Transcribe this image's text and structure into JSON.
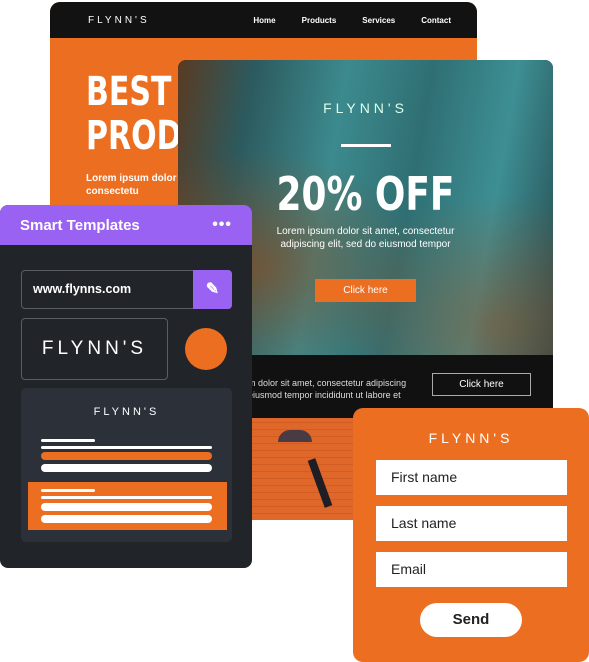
{
  "back_card": {
    "logo": "FLYNN'S",
    "nav": [
      "Home",
      "Products",
      "Services",
      "Contact"
    ],
    "headline_1": "BEST W",
    "headline_2": "PRODU",
    "body": "Lorem ipsum dolor sit amet consectetu"
  },
  "promo_card": {
    "logo": "FLYNN'S",
    "headline": "20% OFF",
    "body": "Lorem ipsum dolor sit amet, consectetur adipiscing elit, sed do eiusmod tempor",
    "cta": "Click here",
    "strip_text_1": "m dolor sit amet, consectetur adipiscing",
    "strip_text_2": "eiusmod tempor incididunt ut labore et",
    "strip_cta": "Click here"
  },
  "smart_templates": {
    "title": "Smart Templates",
    "menu_icon": "more-horizontal-icon",
    "url_value": "www.flynns.com",
    "wand_icon": "magic-wand-icon",
    "logo": "FLYNN'S",
    "brand_color": "#ec6e21",
    "preview_logo": "FLYNN'S",
    "accent": "#9a62f2"
  },
  "form_card": {
    "logo": "FLYNN'S",
    "fields": [
      "First name",
      "Last name",
      "Email"
    ],
    "submit": "Send"
  }
}
